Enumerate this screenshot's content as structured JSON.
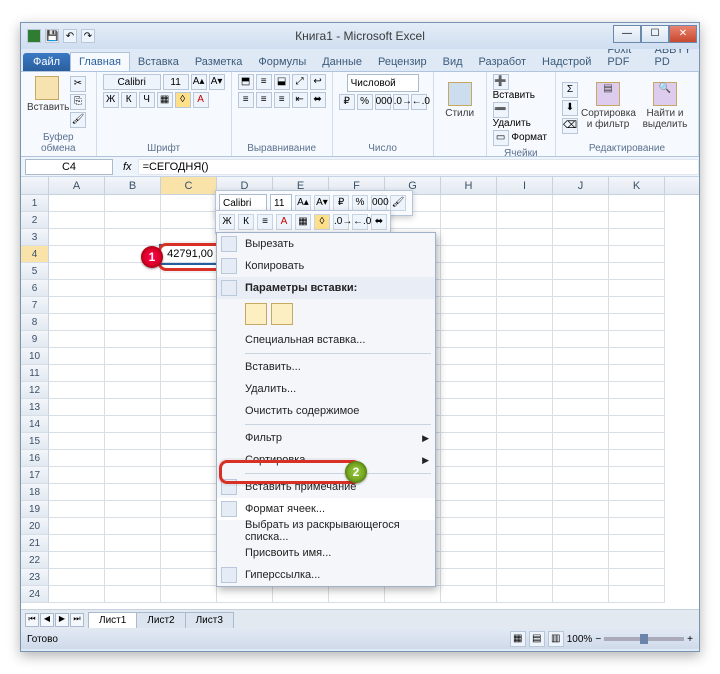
{
  "app": {
    "title": "Книга1 - Microsoft Excel"
  },
  "window_buttons": {
    "min": "—",
    "max": "☐",
    "close": "✕"
  },
  "tabs": {
    "file": "Файл",
    "items": [
      "Главная",
      "Вставка",
      "Разметка",
      "Формулы",
      "Данные",
      "Рецензир",
      "Вид",
      "Разработ",
      "Надстрой",
      "Foxit PDF",
      "ABBYY PD"
    ],
    "active": "Главная"
  },
  "ribbon": {
    "clipboard": {
      "paste": "Вставить",
      "label": "Буфер обмена"
    },
    "font": {
      "family": "Calibri",
      "size": "11",
      "label": "Шрифт",
      "bold": "Ж",
      "italic": "К",
      "underline": "Ч"
    },
    "align": {
      "label": "Выравнивание"
    },
    "number": {
      "format": "Числовой",
      "label": "Число"
    },
    "styles": {
      "btn": "Стили"
    },
    "cells": {
      "insert": "Вставить",
      "delete": "Удалить",
      "format": "Формат",
      "label": "Ячейки"
    },
    "editing": {
      "sort": "Сортировка и фильтр",
      "find": "Найти и выделить",
      "label": "Редактирование"
    }
  },
  "formula_bar": {
    "name": "C4",
    "fx": "fx",
    "formula": "=СЕГОДНЯ()"
  },
  "columns": [
    "A",
    "B",
    "C",
    "D",
    "E",
    "F",
    "G",
    "H",
    "I",
    "J",
    "K"
  ],
  "rows_visible": 24,
  "active_cell": {
    "ref": "C4",
    "value": "42791,00"
  },
  "mini_toolbar": {
    "font": "Calibri",
    "size": "11",
    "bold": "Ж",
    "italic": "К"
  },
  "context_menu": {
    "cut": "Вырезать",
    "copy": "Копировать",
    "paste_header": "Параметры вставки:",
    "paste_special": "Специальная вставка...",
    "insert": "Вставить...",
    "delete": "Удалить...",
    "clear": "Очистить содержимое",
    "filter": "Фильтр",
    "sort": "Сортировка",
    "comment": "Вставить примечание",
    "format_cells": "Формат ячеек...",
    "dropdown": "Выбрать из раскрывающегося списка...",
    "name": "Присвоить имя...",
    "hyperlink": "Гиперссылка..."
  },
  "sheets": {
    "s1": "Лист1",
    "s2": "Лист2",
    "s3": "Лист3"
  },
  "status": {
    "ready": "Готово",
    "zoom": "100%"
  },
  "callouts": {
    "one": "1",
    "two": "2"
  }
}
